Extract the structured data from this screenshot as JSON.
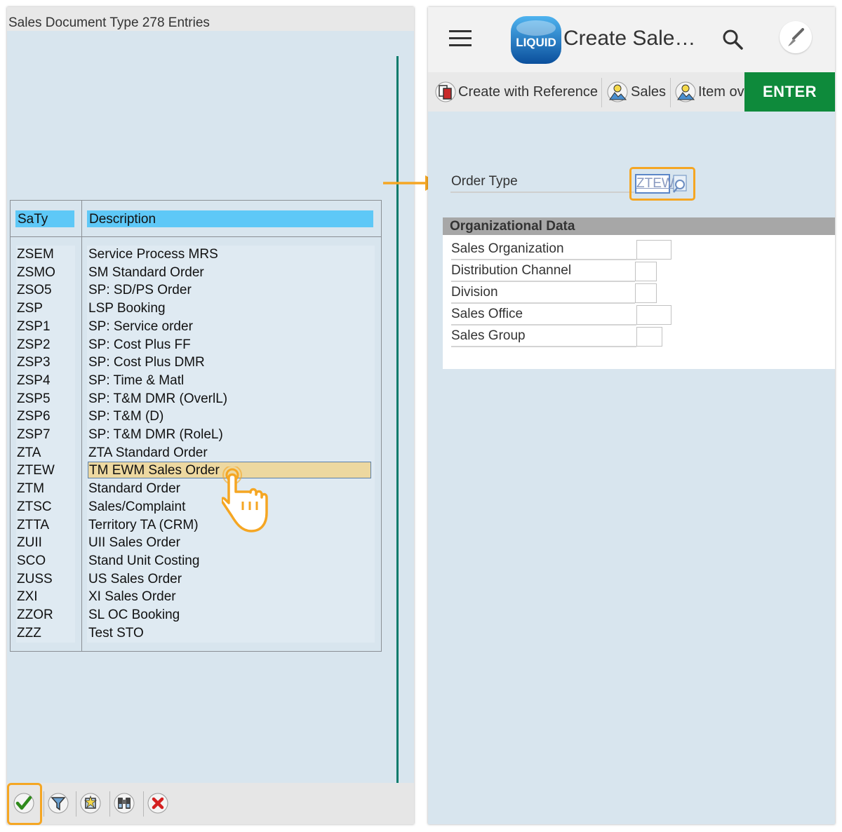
{
  "left_panel": {
    "title": "Sales Document Type 278 Entries",
    "columns": {
      "code": "SaTy",
      "description": "Description"
    },
    "rows": [
      {
        "code": "ZSEM",
        "description": "Service Process MRS"
      },
      {
        "code": "ZSMO",
        "description": "SM Standard Order"
      },
      {
        "code": "ZSO5",
        "description": "SP: SD/PS Order"
      },
      {
        "code": "ZSP",
        "description": "LSP Booking"
      },
      {
        "code": "ZSP1",
        "description": "SP: Service order"
      },
      {
        "code": "ZSP2",
        "description": "SP: Cost Plus FF"
      },
      {
        "code": "ZSP3",
        "description": "SP: Cost Plus DMR"
      },
      {
        "code": "ZSP4",
        "description": "SP: Time & Matl"
      },
      {
        "code": "ZSP5",
        "description": "SP: T&M DMR (OverlL)"
      },
      {
        "code": "ZSP6",
        "description": "SP: T&M (D)"
      },
      {
        "code": "ZSP7",
        "description": "SP: T&M DMR (RoleL)"
      },
      {
        "code": "ZTA",
        "description": "ZTA Standard Order"
      },
      {
        "code": "ZTEW",
        "description": "TM EWM Sales Order"
      },
      {
        "code": "ZTM",
        "description": "Standard Order"
      },
      {
        "code": "ZTSC",
        "description": "Sales/Complaint"
      },
      {
        "code": "ZTTA",
        "description": "Territory TA (CRM)"
      },
      {
        "code": "ZUII",
        "description": "UII Sales Order"
      },
      {
        "code": "SCO",
        "description": "Stand Unit Costing"
      },
      {
        "code": "ZUSS",
        "description": "US Sales Order"
      },
      {
        "code": "ZXI",
        "description": "XI Sales Order"
      },
      {
        "code": "ZZOR",
        "description": "SL OC Booking"
      },
      {
        "code": "ZZZ",
        "description": "Test STO"
      }
    ],
    "selected_code": "ZTEW",
    "toolbar_icons": [
      "checkmark-icon",
      "filter-icon",
      "new-entry-icon",
      "binoculars-icon",
      "cancel-icon"
    ]
  },
  "right_panel": {
    "logo_text": "LIQUID",
    "app_title": "Create Sale…",
    "tabs": [
      {
        "label": "Create with Reference"
      },
      {
        "label": "Sales"
      },
      {
        "label": "Item ov"
      }
    ],
    "enter_label": "ENTER",
    "order_type_label": "Order Type",
    "order_type_value": "ZTEW",
    "org_section_title": "Organizational Data",
    "org_fields": [
      {
        "label": "Sales Organization",
        "value": ""
      },
      {
        "label": "Distribution Channel",
        "value": ""
      },
      {
        "label": "Division",
        "value": ""
      },
      {
        "label": "Sales Office",
        "value": ""
      },
      {
        "label": "Sales Group",
        "value": ""
      }
    ]
  },
  "colors": {
    "panel_bg": "#d8e5ee",
    "header_highlight": "#5ec8f7",
    "selected_row": "#edd8a0",
    "accent_orange": "#f5a623",
    "enter_green": "#0e8a3b",
    "divider_teal": "#0a7b6b"
  }
}
